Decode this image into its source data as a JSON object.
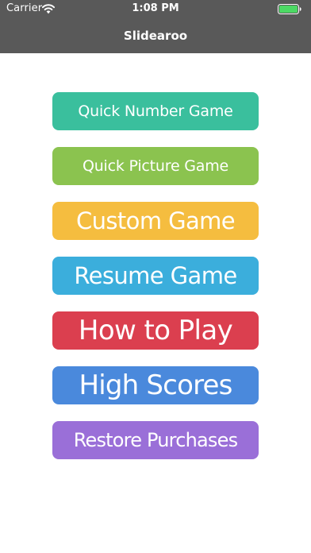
{
  "status_bar": {
    "carrier": "Carrier",
    "time": "1:08 PM",
    "battery_icon": "battery-icon",
    "wifi_icon": "wifi-icon",
    "battery_color": "#4cd964"
  },
  "nav": {
    "title": "Slidearoo",
    "background_color": "#595959"
  },
  "menu": {
    "buttons": [
      {
        "label": "Quick Number Game",
        "color": "#3abf9d"
      },
      {
        "label": "Quick Picture Game",
        "color": "#8bc34f"
      },
      {
        "label": "Custom Game",
        "color": "#f5bd3f"
      },
      {
        "label": "Resume Game",
        "color": "#3baedc"
      },
      {
        "label": "How to Play",
        "color": "#db3f4f"
      },
      {
        "label": "High Scores",
        "color": "#4a89dc"
      },
      {
        "label": "Restore Purchases",
        "color": "#9a6fd8"
      }
    ]
  }
}
